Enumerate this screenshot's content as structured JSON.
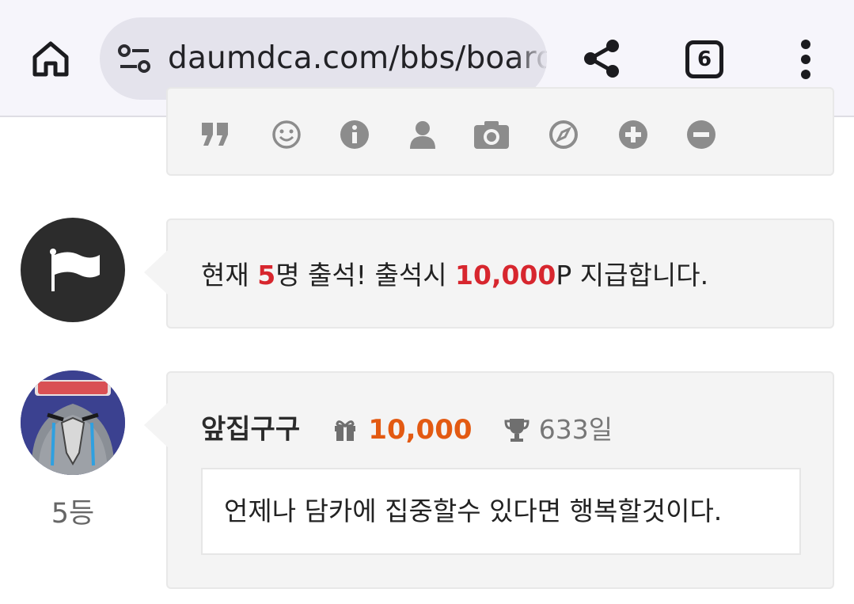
{
  "browser": {
    "url": "daumdca.com/bbs/board",
    "tab_count": "6",
    "icons": [
      "home-icon",
      "site-settings-icon",
      "share-icon",
      "tab-switcher-icon",
      "more-vert-icon"
    ]
  },
  "toolbar": {
    "icons": [
      "quote-icon",
      "emoji-icon",
      "info-icon",
      "person-icon",
      "camera-icon",
      "compass-icon",
      "plus-icon",
      "minus-icon"
    ]
  },
  "attendance": {
    "prefix": "현재 ",
    "count": "5",
    "mid": "명 출석! 출석시 ",
    "points": "10,000",
    "suffix": "P 지급합니다."
  },
  "post": {
    "nickname": "앞집구구",
    "points": "10,000",
    "days": "633일",
    "rank": "5등",
    "message": "언제나 담카에 집중할수 있다면 행복할것이다."
  },
  "colors": {
    "accent_red": "#d7262e",
    "accent_orange": "#e35a12",
    "bubble_bg": "#f4f4f4",
    "browser_bg": "#f6f5fb"
  }
}
